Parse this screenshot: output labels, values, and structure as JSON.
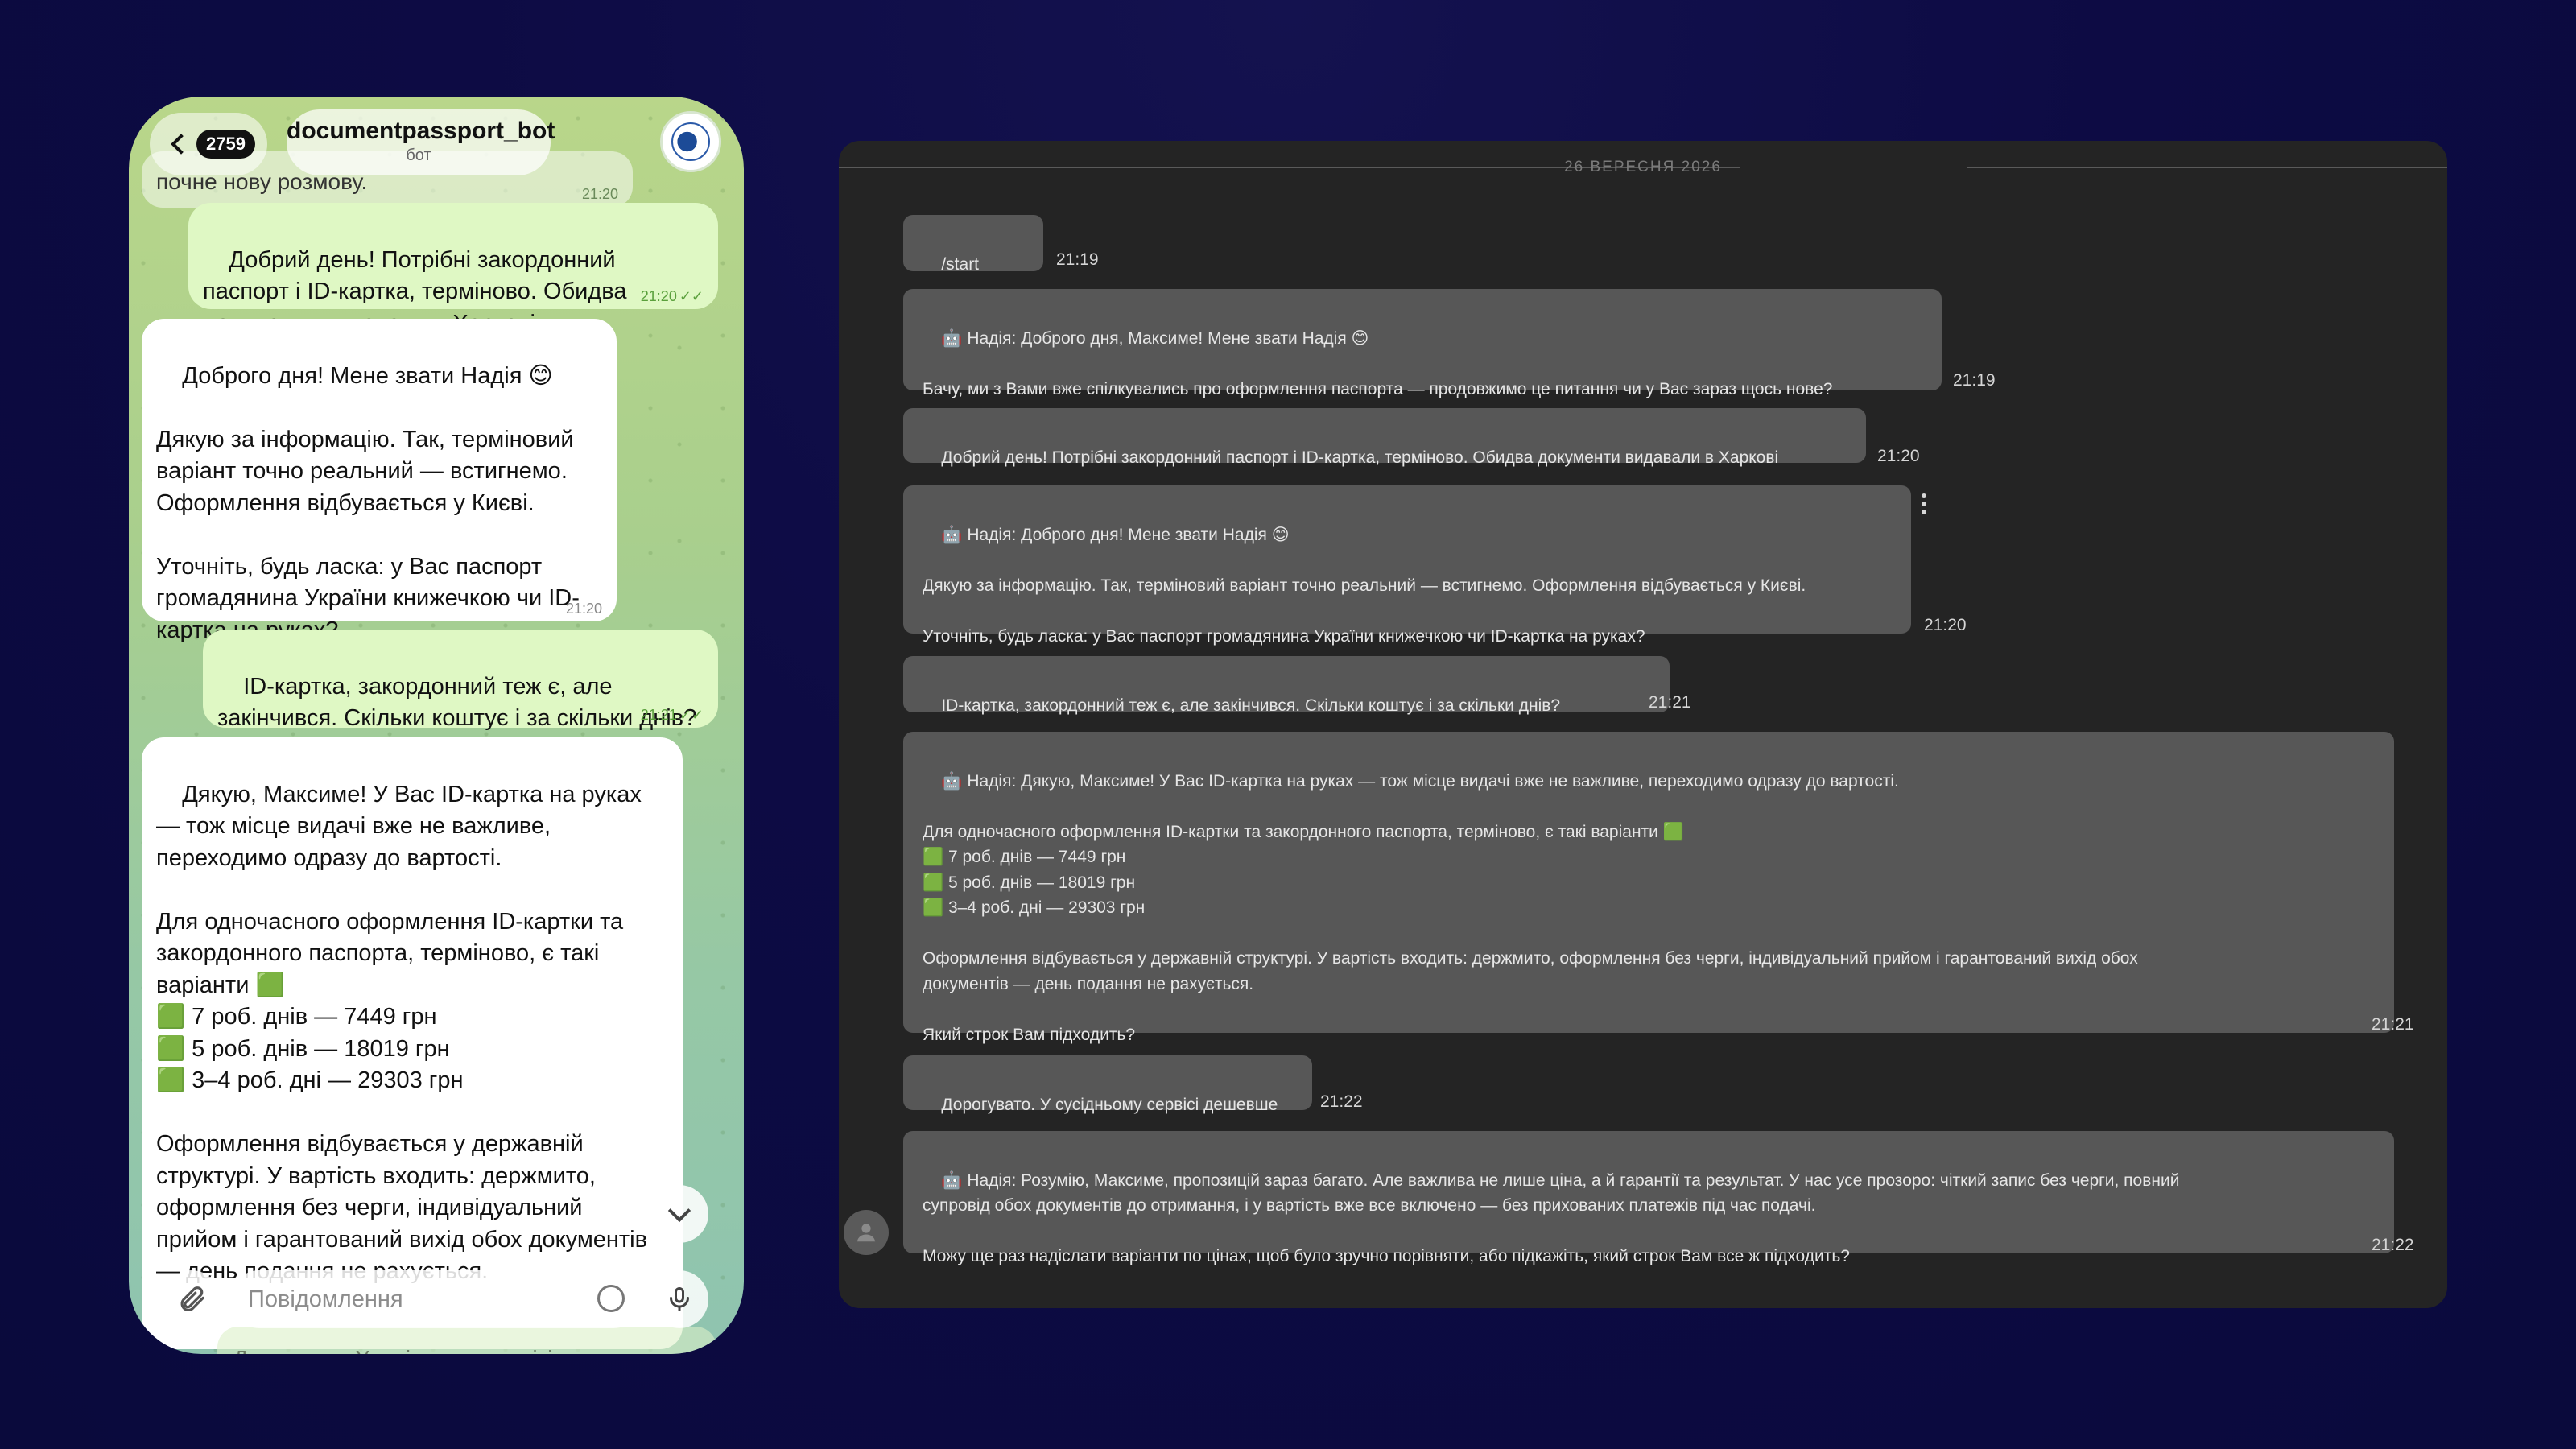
{
  "phone": {
    "back_badge": "2759",
    "bot_name": "documentpassport_bot",
    "bot_subtitle": "бот",
    "faded_text": "почне нову розмову.",
    "faded_time": "21:20",
    "messages": [
      {
        "dir": "out",
        "text": "Добрий день! Потрібні закордонний паспорт і ID-картка, терміново. Обидва документи видавали в Харкові",
        "time": "21:20"
      },
      {
        "dir": "in",
        "text": "Доброго дня! Мене звати Надія 😊\n\nДякую за інформацію. Так, терміновий варіант точно реальний — встигнемо. Оформлення відбувається у Києві.\n\nУточніть, будь ласка: у Вас паспорт громадянина України книжечкою чи ID-картка на руках?",
        "time": "21:20"
      },
      {
        "dir": "out",
        "text": "ID-картка, закордонний теж є, але закінчився. Скільки коштує і за скільки днів?",
        "time": "21:21"
      },
      {
        "dir": "in",
        "text": "Дякую, Максиме! У Вас ID-картка на руках — тож місце видачі вже не важливе, переходимо одразу до вартості.\n\nДля одночасного оформлення ID-картки та закордонного паспорта, терміново, є такі варіанти 🟩\n🟩 7 роб. днів — 7449 грн\n🟩 5 роб. днів — 18019 грн\n🟩 3–4 роб. дні — 29303 грн\n\nОформлення відбувається у державній структурі. У вартість входить: держмито, оформлення без черги, індивідуальний прийом і гарантований вихід обох документів — день подання не рахується.",
        "time": ""
      }
    ],
    "input_placeholder": "Повідомлення",
    "ghost_text": "Дорогувато. У сусідньому сервісі дешевше"
  },
  "desktop": {
    "date_label": "26 ВЕРЕСНЯ 2026",
    "messages": [
      {
        "text": "/start",
        "time": "21:19"
      },
      {
        "text": "🤖 Надія: Доброго дня, Максиме! Мене звати Надія 😊\n\nБачу, ми з Вами вже спілкувались про оформлення паспорта — продовжимо це питання чи у Вас зараз щось нове?",
        "time": "21:19"
      },
      {
        "text": "Добрий день! Потрібні закордонний паспорт і ID-картка, терміново. Обидва документи видавали в Харкові",
        "time": "21:20"
      },
      {
        "text": "🤖 Надія: Доброго дня! Мене звати Надія 😊\n\nДякую за інформацію. Так, терміновий варіант точно реальний — встигнемо. Оформлення відбувається у Києві.\n\nУточніть, будь ласка: у Вас паспорт громадянина України книжечкою чи ID-картка на руках?",
        "time": "21:20"
      },
      {
        "text": "ID-картка, закордонний теж є, але закінчився. Скільки коштує і за скільки днів?",
        "time": "21:21"
      },
      {
        "text": "🤖 Надія: Дякую, Максиме! У Вас ID-картка на руках — тож місце видачі вже не важливе, переходимо одразу до вартості.\n\nДля одночасного оформлення ID-картки та закордонного паспорта, терміново, є такі варіанти 🟩\n🟩 7 роб. днів — 7449 грн\n🟩 5 роб. днів — 18019 грн\n🟩 3–4 роб. дні — 29303 грн\n\nОформлення відбувається у державній структурі. У вартість входить: держмито, оформлення без черги, індивідуальний прийом і гарантований вихід обох\nдокументів — день подання не рахується.\n\nЯкий строк Вам підходить?",
        "time": "21:21"
      },
      {
        "text": "Дорогувато. У сусідньому сервісі дешевше",
        "time": "21:22"
      },
      {
        "text": "🤖 Надія: Розумію, Максиме, пропозицій зараз багато. Але важлива не лише ціна, а й гарантії та результат. У нас усе прозоро: чіткий запис без черги, повний\nсупровід обох документів до отримання, і у вартість вже все включено — без прихованих платежів під час подачі.\n\nМожу ще раз надіслати варіанти по цінах, щоб було зручно порівняти, або підкажіть, який строк Вам все ж підходить?",
        "time": "21:22"
      }
    ]
  }
}
